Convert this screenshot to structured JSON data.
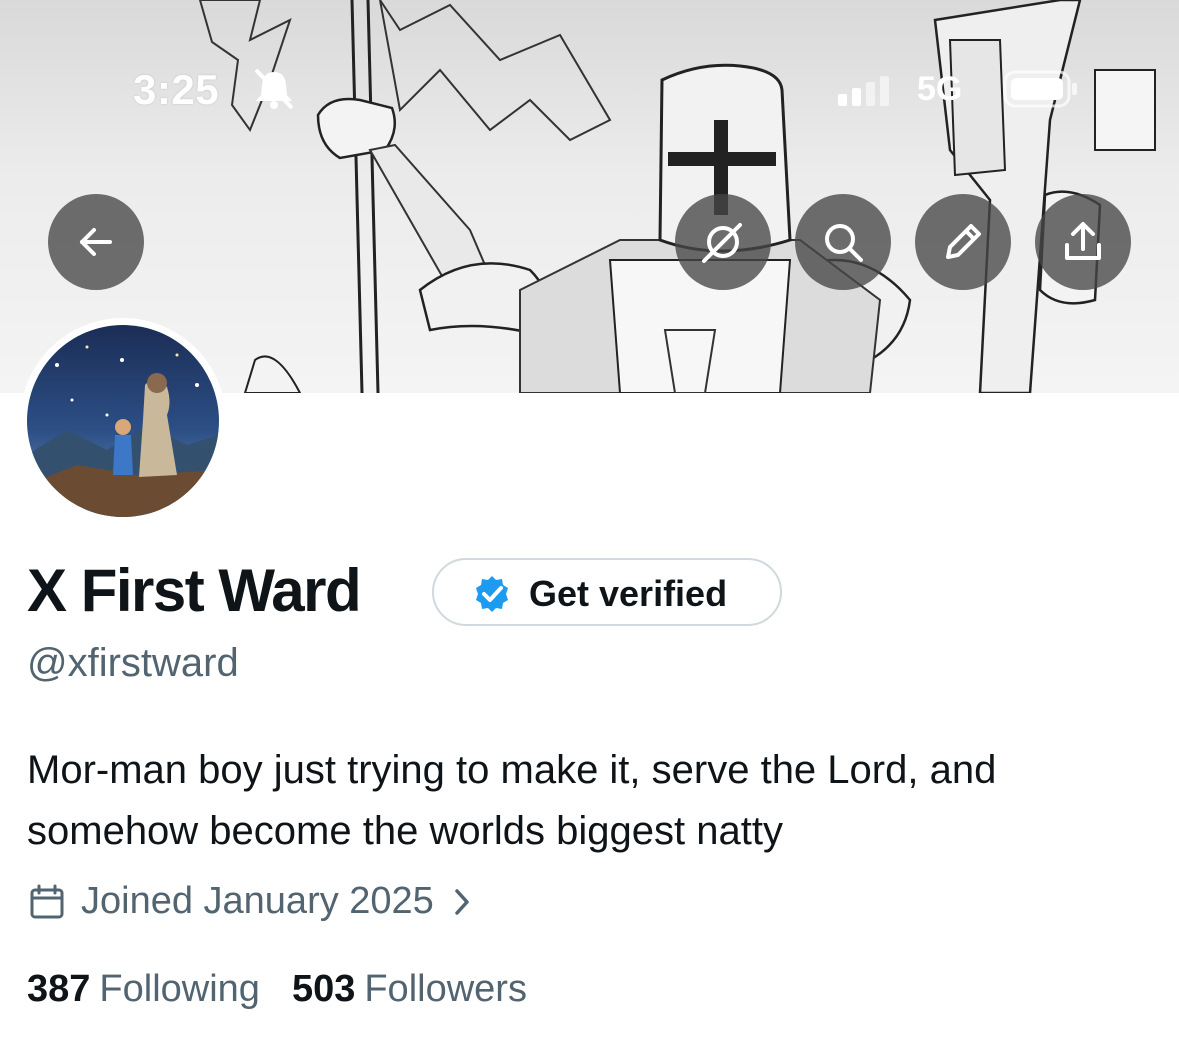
{
  "status_bar": {
    "time": "3:25",
    "network": "5G",
    "icons": [
      "bell-off-icon",
      "signal-icon",
      "battery-icon"
    ]
  },
  "header_actions": {
    "back": "back-arrow-icon",
    "grok": "grok-icon",
    "search": "search-icon",
    "edit": "pencil-icon",
    "share": "share-icon"
  },
  "profile": {
    "name": "X First Ward",
    "verify_label": "Get verified",
    "handle": "@xfirstward",
    "bio": "Mor-man boy just trying to make it, serve the Lord, and somehow become the worlds biggest natty",
    "joined": "Joined January 2025",
    "following_count": "387",
    "following_label": "Following",
    "followers_count": "503",
    "followers_label": "Followers"
  },
  "colors": {
    "text_primary": "#0f1419",
    "text_secondary": "#536471",
    "verified_blue": "#1d9bf0",
    "border": "#cfd9de"
  }
}
